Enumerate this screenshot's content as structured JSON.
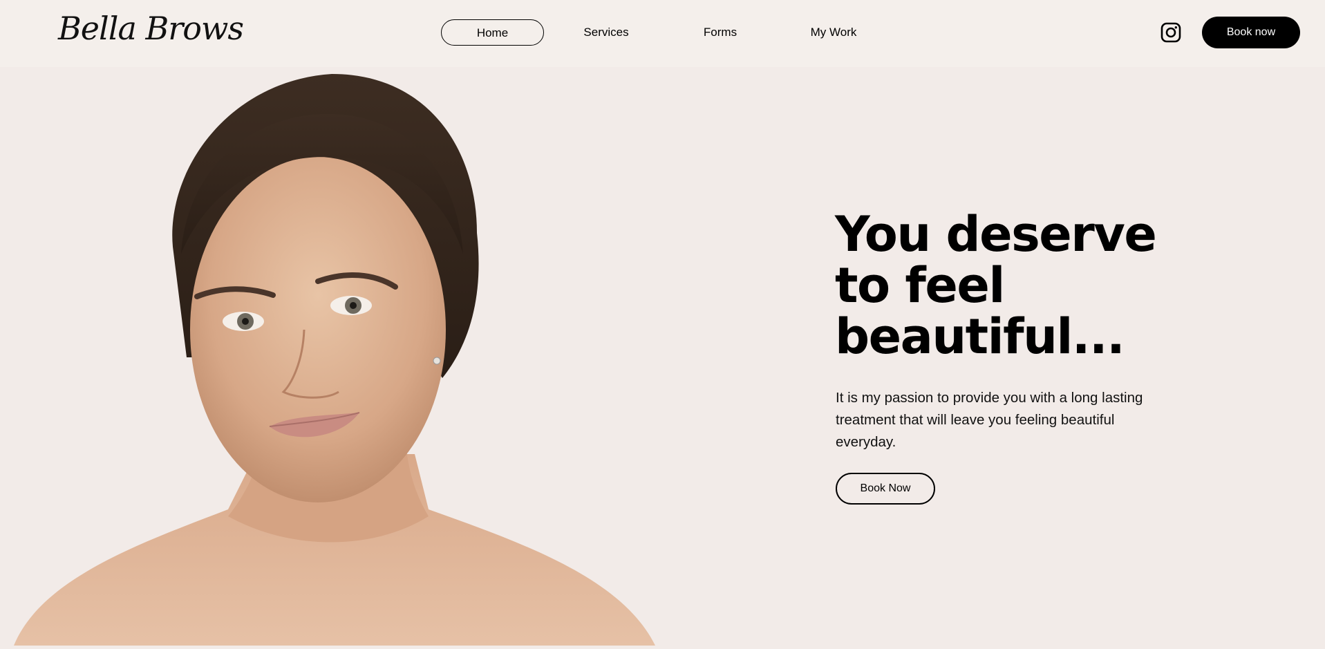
{
  "brand": {
    "logo_text": "Bella Brows"
  },
  "nav": {
    "items": [
      {
        "label": "Home",
        "active": true
      },
      {
        "label": "Services",
        "active": false
      },
      {
        "label": "Forms",
        "active": false
      },
      {
        "label": "My Work",
        "active": false
      }
    ]
  },
  "header": {
    "social_icon": "instagram-icon",
    "book_label": "Book now"
  },
  "hero": {
    "headline_lines": [
      "You deserve",
      "to feel",
      "beautiful..."
    ],
    "paragraph": "It is my passion to provide you with a long lasting treatment that will leave you feeling beautiful everyday.",
    "cta_label": "Book Now",
    "photo": "portrait-photo"
  },
  "colors": {
    "background": "#f2ebe8",
    "header_background": "#f4efeb",
    "accent": "#000000",
    "button_text": "#ffffff"
  }
}
